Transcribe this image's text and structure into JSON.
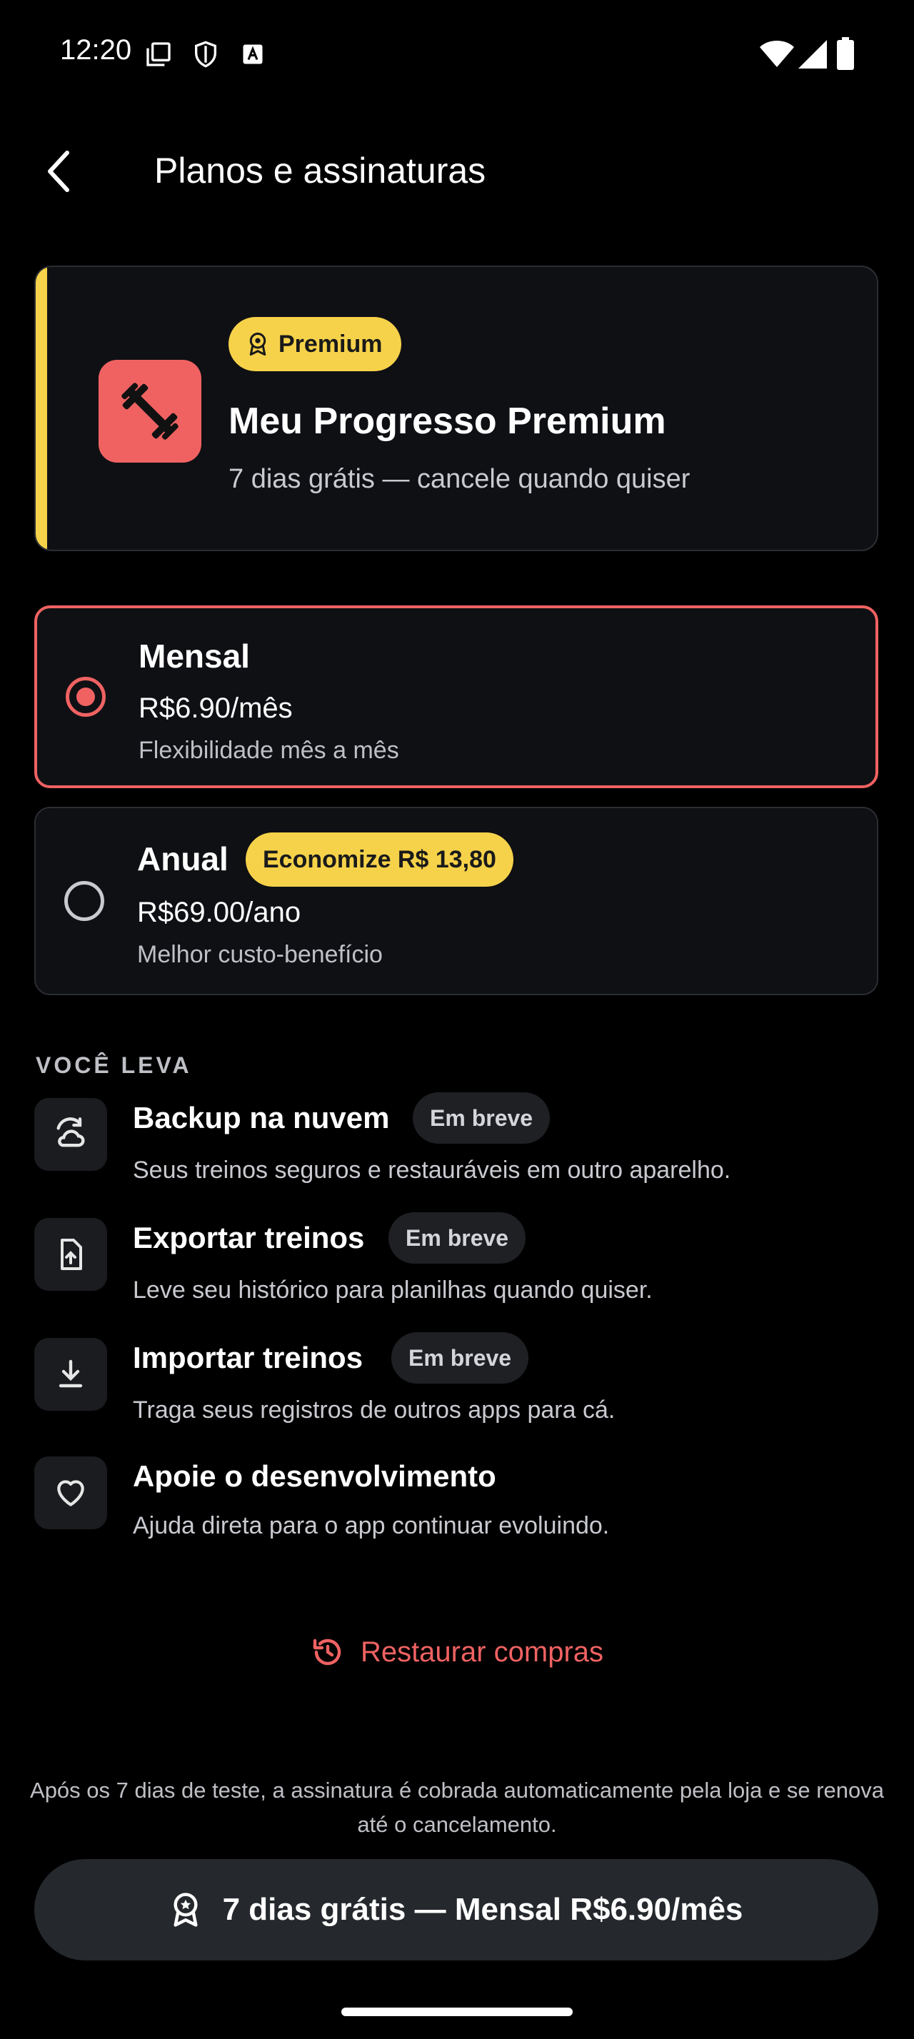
{
  "status_bar": {
    "time": "12:20",
    "icons": [
      "copy-icon",
      "shield-icon",
      "text-box-icon",
      "wifi-icon",
      "signal-icon",
      "battery-icon"
    ]
  },
  "header": {
    "back_icon": "chevron-left-icon",
    "title": "Planos e assinaturas"
  },
  "premium_card": {
    "badge": "Premium",
    "title": "Meu Progresso Premium",
    "subtitle": "7 dias grátis — cancele quando quiser",
    "accent_color": "#f6d24a",
    "icon_bg": "#f06262",
    "app_icon": "dumbbell-icon"
  },
  "plans": [
    {
      "name": "Mensal",
      "price": "R$6.90/mês",
      "description": "Flexibilidade mês a mês",
      "selected": true
    },
    {
      "name": "Anual",
      "badge": "Economize R$ 13,80",
      "price": "R$69.00/ano",
      "description": "Melhor custo-benefício",
      "selected": false
    }
  ],
  "features": {
    "label": "VOCÊ LEVA",
    "items": [
      {
        "title": "Backup na nuvem",
        "badge": "Em breve",
        "description": "Seus treinos seguros e restauráveis em outro aparelho.",
        "icon": "cloud-restore-icon"
      },
      {
        "title": "Exportar treinos",
        "badge": "Em breve",
        "description": "Leve seu histórico para planilhas quando quiser.",
        "icon": "file-upload-icon"
      },
      {
        "title": "Importar treinos",
        "badge": "Em breve",
        "description": "Traga seus registros de outros apps para cá.",
        "icon": "download-icon"
      },
      {
        "title": "Apoie o desenvolvimento",
        "description": "Ajuda direta para o app continuar evoluindo.",
        "icon": "heart-icon"
      }
    ]
  },
  "restore": {
    "label": "Restaurar compras",
    "icon": "history-icon"
  },
  "legal_text": "Após os 7 dias de teste, a assinatura é cobrada automaticamente pela loja e se renova até o cancelamento.",
  "cta": {
    "label": "7 dias grátis — Mensal R$6.90/mês",
    "icon": "award-icon"
  },
  "colors": {
    "accent_red": "#f06262",
    "accent_yellow": "#f6d24a",
    "card_bg": "#0f1014",
    "cta_bg": "#25282c"
  }
}
